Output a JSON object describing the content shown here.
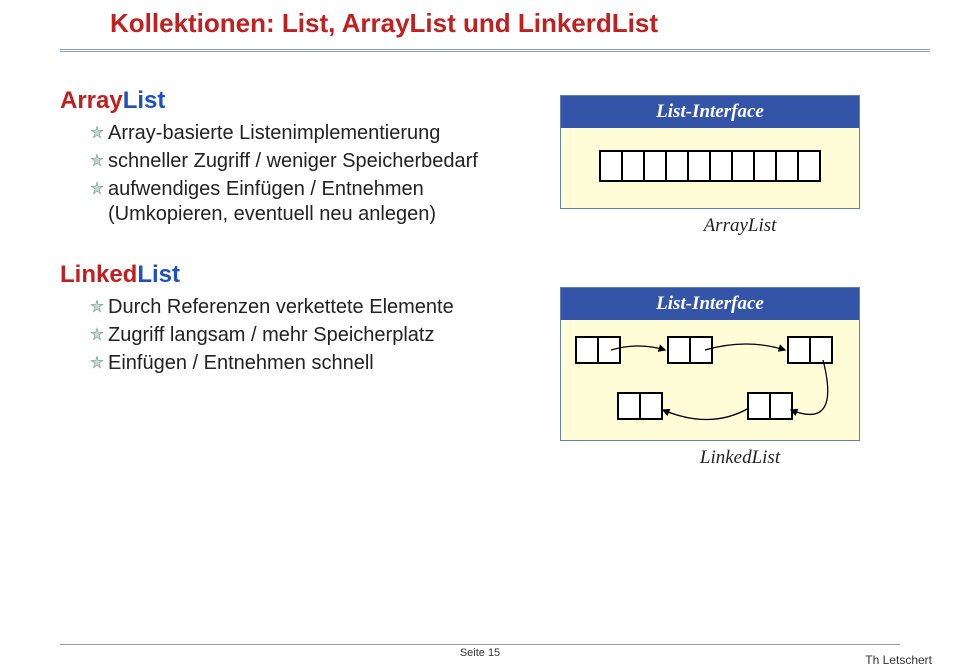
{
  "title": "Kollektionen: List, ArrayList und LinkerdList",
  "section1": {
    "name_part1": "Array",
    "name_part2": "List",
    "bullets": [
      "Array-basierte Listenimplementierung",
      "schneller Zugriff / weniger Speicherbedarf",
      "aufwendiges Einfügen / Entnehmen (Umkopieren, eventuell neu anlegen)"
    ]
  },
  "section2": {
    "name_part1": "Linked",
    "name_part2": "List",
    "bullets": [
      "Durch Referenzen verkettete Elemente",
      "Zugriff langsam / mehr Speicherplatz",
      "Einfügen / Entnehmen schnell"
    ]
  },
  "diagram1": {
    "header": "List-Interface",
    "caption": "ArrayList",
    "cell_count": 10
  },
  "diagram2": {
    "header": "List-Interface",
    "caption": "LinkedList"
  },
  "footer": {
    "page_label": "Seite 15",
    "author": "Th Letschert"
  }
}
